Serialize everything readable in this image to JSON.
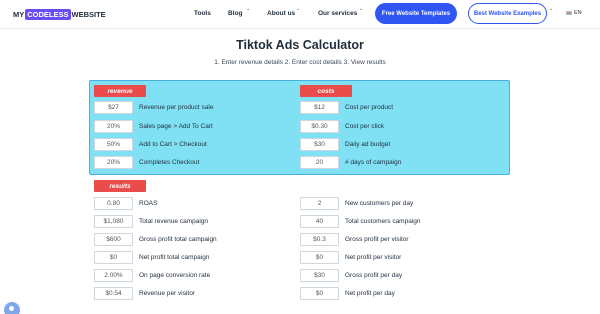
{
  "nav": {
    "logo": {
      "part1": "MY",
      "highlight": "CODELESS",
      "part2": "WEBSITE"
    },
    "items": [
      {
        "label": "Tools",
        "has_dropdown": false
      },
      {
        "label": "Blog",
        "has_dropdown": true
      },
      {
        "label": "About us",
        "has_dropdown": true
      },
      {
        "label": "Our services",
        "has_dropdown": true
      }
    ],
    "cta_primary": "Free Website Templates",
    "cta_secondary": "Best Website Examples",
    "language": "EN"
  },
  "page": {
    "title": "Tiktok Ads Calculator",
    "subtitle": "1. Enter revenue details 2. Enter cost details 3. View results"
  },
  "revenue": {
    "badge": "revenue",
    "fields": [
      {
        "value": "$27",
        "label": "Revenue per product sale"
      },
      {
        "value": "20%",
        "label": "Sales page > Add To Cart"
      },
      {
        "value": "50%",
        "label": "Add to Cart > Checkout"
      },
      {
        "value": "20%",
        "label": "Completes Checkout"
      }
    ]
  },
  "costs": {
    "badge": "costs",
    "fields": [
      {
        "value": "$12",
        "label": "Cost per product"
      },
      {
        "value": "$0.30",
        "label": "Cost per click"
      },
      {
        "value": "$30",
        "label": "Daily ad budget"
      },
      {
        "value": "20",
        "label": "# days of campaign"
      }
    ]
  },
  "results": {
    "badge": "results",
    "left": [
      {
        "value": "0.80",
        "label": "ROAS"
      },
      {
        "value": "$1,080",
        "label": "Total revenue campaign"
      },
      {
        "value": "$600",
        "label": "Gross profit total campaign"
      },
      {
        "value": "$0",
        "label": "Net profit total campaign"
      },
      {
        "value": "2.00%",
        "label": "On page conversion rate"
      },
      {
        "value": "$0.54",
        "label": "Revenue per visitor"
      }
    ],
    "right": [
      {
        "value": "2",
        "label": "New customers per day"
      },
      {
        "value": "40",
        "label": "Total customers campaign"
      },
      {
        "value": "$0.3",
        "label": "Gross profit per visitor"
      },
      {
        "value": "$0",
        "label": "Net profit per visitor"
      },
      {
        "value": "$30",
        "label": "Gross profit per day"
      },
      {
        "value": "$0",
        "label": "Net profit per day"
      }
    ]
  },
  "colors": {
    "accent": "#2f55f3",
    "badge": "#ea4b4b",
    "panel": "#7fe1f3"
  }
}
